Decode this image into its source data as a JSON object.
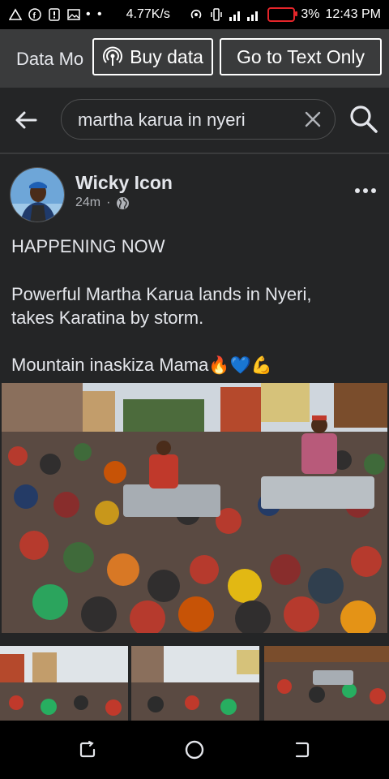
{
  "status_bar": {
    "speed": "4.77K/s",
    "battery": "3%",
    "time": "12:43 PM"
  },
  "data_bar": {
    "label": "Data Mo­",
    "buy_data": "Buy data",
    "text_only": "Go to Text Only"
  },
  "search": {
    "query": "martha karua in nyeri"
  },
  "post": {
    "author": "Wicky Icon",
    "time": "24m",
    "separator": "·",
    "line1": "HAPPENING NOW",
    "line2a": "Powerful Martha Karua lands in Nyeri,",
    "line2b": "takes Karatina by storm.",
    "line3": "Mountain inaskiza Mama",
    "emojis": "🔥💙💪"
  },
  "colors": {
    "background": "#242526",
    "bar": "#3a3b3c",
    "text": "#e4e6eb",
    "muted": "#b0b3b8",
    "battery_low": "#e5252a"
  }
}
